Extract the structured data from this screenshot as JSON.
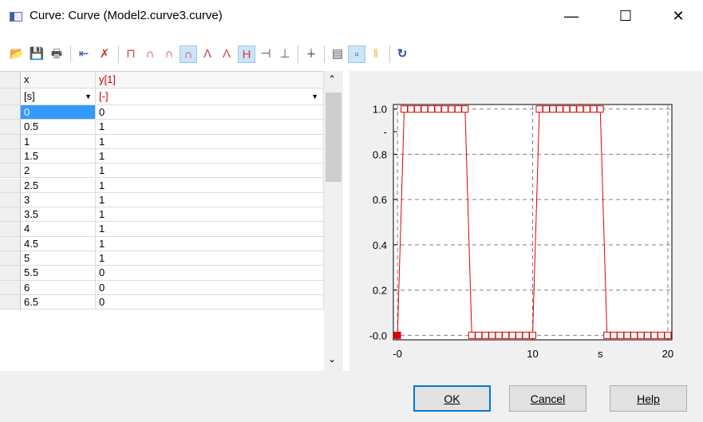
{
  "window": {
    "title": "Curve: Curve (Model2.curve3.curve)",
    "minimize": "—",
    "maximize": "☐",
    "close": "✕"
  },
  "table": {
    "columns": [
      {
        "name": "x",
        "unit": "[s]",
        "color": "#000000"
      },
      {
        "name": "y[1]",
        "unit": "[-]",
        "color": "#d00000"
      }
    ],
    "rows": [
      [
        "0",
        "0"
      ],
      [
        "0.5",
        "1"
      ],
      [
        "1",
        "1"
      ],
      [
        "1.5",
        "1"
      ],
      [
        "2",
        "1"
      ],
      [
        "2.5",
        "1"
      ],
      [
        "3",
        "1"
      ],
      [
        "3.5",
        "1"
      ],
      [
        "4",
        "1"
      ],
      [
        "4.5",
        "1"
      ],
      [
        "5",
        "1"
      ],
      [
        "5.5",
        "0"
      ],
      [
        "6",
        "0"
      ],
      [
        "6.5",
        "0"
      ]
    ],
    "selected_cell_color": "#3399ff"
  },
  "plot": {
    "y_ticks": [
      "1.0",
      "-",
      "0.8",
      "0.6",
      "0.4",
      "0.2",
      "-0.0"
    ],
    "x_ticks": [
      "-0",
      "10",
      "s",
      "20"
    ],
    "line_color": "#e00000"
  },
  "chart_data": {
    "type": "line",
    "x": [
      0,
      0.5,
      1,
      1.5,
      2,
      2.5,
      3,
      3.5,
      4,
      4.5,
      5,
      5.5,
      6,
      6.5,
      7,
      7.5,
      8,
      8.5,
      9,
      9.5,
      10,
      10.5,
      11,
      11.5,
      12,
      12.5,
      13,
      13.5,
      14,
      14.5,
      15,
      15.5,
      16,
      16.5,
      17,
      17.5,
      18,
      18.5,
      19,
      19.5,
      20
    ],
    "series": [
      {
        "values": [
          0,
          1,
          1,
          1,
          1,
          1,
          1,
          1,
          1,
          1,
          1,
          0,
          0,
          0,
          0,
          0,
          0,
          0,
          0,
          0,
          0,
          1,
          1,
          1,
          1,
          1,
          1,
          1,
          1,
          1,
          1,
          0,
          0,
          0,
          0,
          0,
          0,
          0,
          0,
          0,
          0
        ]
      }
    ],
    "xlim": [
      0,
      20
    ],
    "ylim": [
      0,
      1
    ],
    "grid": true
  },
  "buttons": {
    "ok": "OK",
    "cancel": "Cancel",
    "help": "Help"
  },
  "toolbar": {
    "icons": [
      "open-icon",
      "save-icon",
      "print-icon",
      "insert-row-icon",
      "delete-row-icon",
      "interp-step-icon",
      "interp-linear-icon",
      "interp-spline-icon",
      "interp-smooth-icon",
      "interp-akima-icon",
      "interp-fritsch-icon",
      "extrapolate-hold-icon",
      "extrapolate-linear-icon",
      "extrapolate-periodic-icon",
      "extrapolate-none-icon",
      "table-view-icon",
      "show-points-icon",
      "columns-icon",
      "reload-icon"
    ]
  }
}
